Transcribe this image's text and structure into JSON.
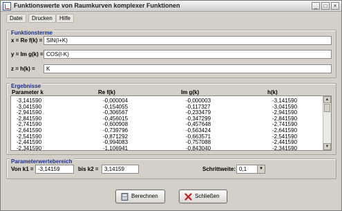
{
  "window": {
    "title": "Funktionswerte von Raumkurven komplexer Funktionen",
    "controls": {
      "minimize": "_",
      "maximize": "□",
      "close": "×"
    }
  },
  "menu": {
    "items": [
      {
        "label": "Datei"
      },
      {
        "label": "Drucken"
      },
      {
        "label": "Hilfe"
      }
    ]
  },
  "funktionsterme": {
    "title": "Funktionsterme",
    "x_label": "x = Re f(k) =",
    "x_value": "SIN(I+K)",
    "y_label": "y = Im g(k) =",
    "y_value": "COS(I-K)",
    "z_label": "z = h(k) =",
    "z_value": "K"
  },
  "ergebnisse": {
    "title": "Ergebnisse",
    "headers": [
      "Parameter k",
      "Re f(k)",
      "Im g(k)",
      "h(k)"
    ],
    "rows": [
      [
        "-3,141590",
        "-0,000004",
        "-0,000003",
        "-3,141590"
      ],
      [
        "-3,041590",
        "-0,154055",
        "-0,117327",
        "-3,041590"
      ],
      [
        "-2,941590",
        "-0,306567",
        "-0,233479",
        "-2,941590"
      ],
      [
        "-2,841590",
        "-0,456015",
        "-0,347299",
        "-2,841590"
      ],
      [
        "-2,741590",
        "-0,600908",
        "-0,457648",
        "-2,741590"
      ],
      [
        "-2,641590",
        "-0,739796",
        "-0,563424",
        "-2,641590"
      ],
      [
        "-2,541590",
        "-0,871292",
        "-0,663571",
        "-2,541590"
      ],
      [
        "-2,441590",
        "-0,994083",
        "-0,757088",
        "-2,441590"
      ],
      [
        "-2,341590",
        "-1,106941",
        "-0,843040",
        "-2,341590"
      ]
    ]
  },
  "parameterbereich": {
    "title": "Parameterwertebereich",
    "from_label": "Von k1 =",
    "from_value": "-3,14159",
    "to_label": "bis k2 =",
    "to_value": "3,14159",
    "step_label": "Schrittweite:",
    "step_value": "0,1"
  },
  "buttons": {
    "berechnen": "Berechnen",
    "schliessen": "Schließen"
  }
}
